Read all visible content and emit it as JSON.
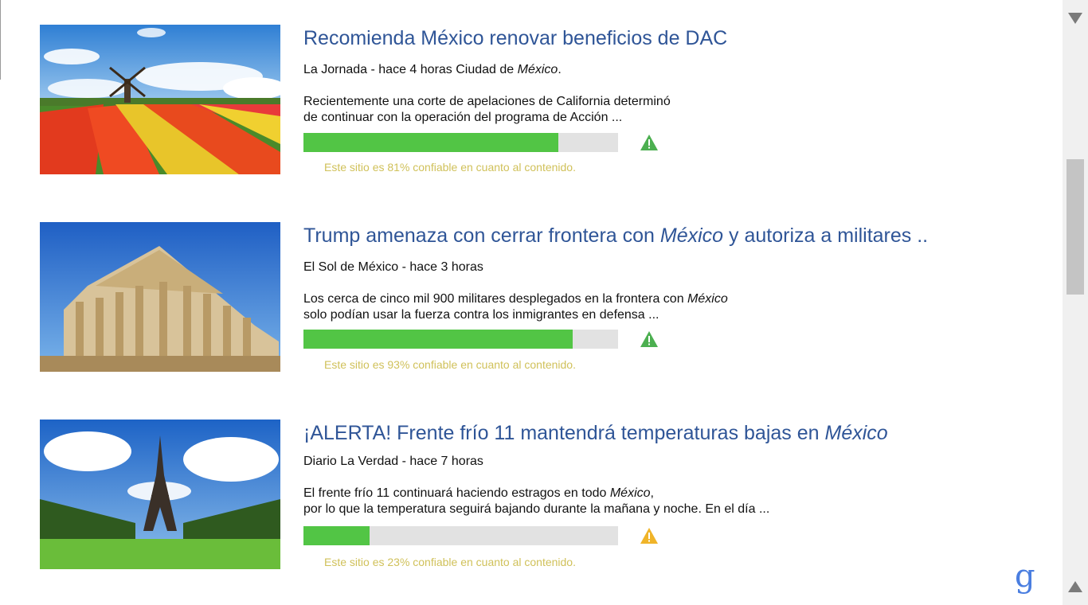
{
  "news": [
    {
      "title_parts": [
        "Recomienda México renovar beneficios de DAC"
      ],
      "source_prefix": "La Jornada - hace 4 horas  Ciudad de ",
      "source_em": "México",
      "source_suffix": ".",
      "snippet_line1_prefix": "Recientemente una corte de apelaciones de California determinó",
      "snippet_line1_em": "",
      "snippet_line1_suffix": "",
      "snippet_line2": "de continuar con la operación del programa de Acción ...",
      "reliability_percent": 81,
      "reliability_text": "Este sitio es 81% confiable en cuanto al contenido.",
      "warn_color": "#4caf50",
      "image_icon": "windmill-tulips-image"
    },
    {
      "title_prefix": "Trump amenaza con cerrar frontera con ",
      "title_em": "México",
      "title_suffix": " y autoriza a militares ..",
      "source_prefix": "El Sol de México - hace 3 horas",
      "snippet_line1_prefix": "Los cerca de cinco mil 900 militares desplegados en la frontera con ",
      "snippet_line1_em": "México",
      "snippet_line2": "solo podían usar la fuerza contra los inmigrantes en defensa ...",
      "reliability_percent": 93,
      "reliability_text": "Este sitio es 93% confiable en cuanto al contenido.",
      "warn_color": "#4caf50",
      "image_icon": "parthenon-image"
    },
    {
      "title_prefix": "¡ALERTA! Frente frío 11 mantendrá temperaturas bajas en ",
      "title_em": "México",
      "source_prefix": "Diario La Verdad - hace 7 horas",
      "snippet_line1_prefix": "El frente frío 11 continuará haciendo estragos en todo ",
      "snippet_line1_em": "México",
      "snippet_line1_suffix": ",",
      "snippet_line2": "por lo que la temperatura seguirá bajando durante la mañana y noche. En el día ...",
      "reliability_percent": 23,
      "reliability_text": "Este sitio es 23% confiable en cuanto al contenido.",
      "warn_color": "#f0b429",
      "image_icon": "eiffel-tower-image"
    }
  ],
  "colors": {
    "title": "#2f5597",
    "bar_fill": "#52c545",
    "bar_track": "#e2e2e2",
    "reliability_text": "#d0c15a"
  },
  "google_glyph": "g",
  "scrollbar_icons": {
    "up": "triangle-down-icon",
    "down": "triangle-up-icon"
  }
}
